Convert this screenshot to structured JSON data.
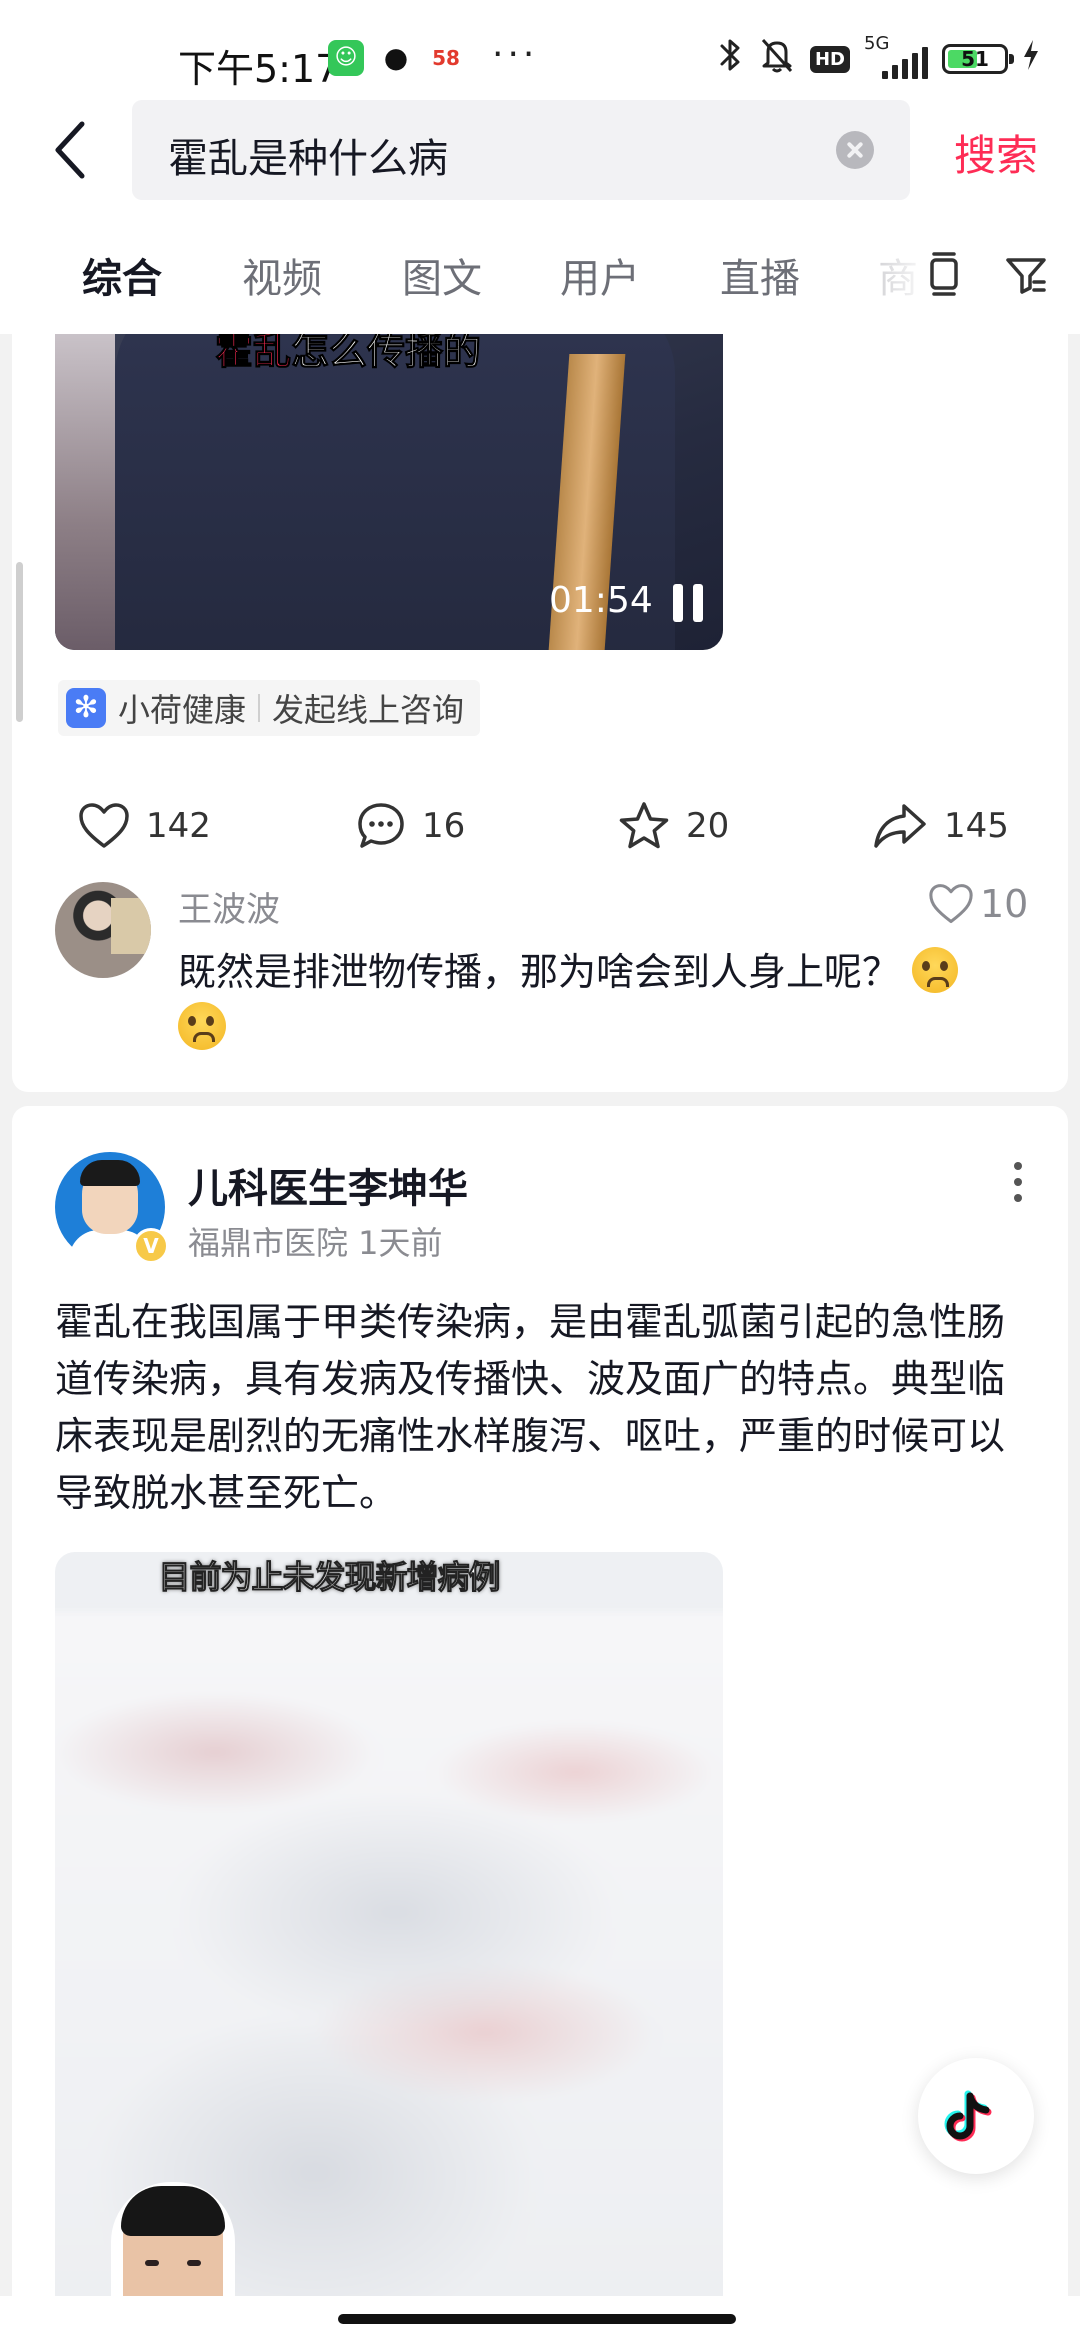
{
  "status_bar": {
    "time": "下午5:17",
    "overflow": "···",
    "network": "5G",
    "hd_label": "HD",
    "battery_level": "51"
  },
  "search": {
    "query": "霍乱是种什么病",
    "submit_label": "搜索"
  },
  "tabs": [
    {
      "label": "综合",
      "active": true
    },
    {
      "label": "视频",
      "active": false
    },
    {
      "label": "图文",
      "active": false
    },
    {
      "label": "用户",
      "active": false
    },
    {
      "label": "直播",
      "active": false
    },
    {
      "label": "商",
      "active": false
    }
  ],
  "post1": {
    "video_caption_highlight": "霍乱",
    "video_caption_rest": "怎么传播的",
    "duration": "01:54",
    "mini_app": {
      "name": "小荷健康",
      "action": "发起线上咨询"
    },
    "stats": {
      "likes": "142",
      "comments": "16",
      "favorites": "20",
      "shares": "145"
    },
    "top_comment": {
      "user": "王波波",
      "likes": "10",
      "text": "既然是排泄物传播，那为啥会到人身上呢？"
    }
  },
  "post2": {
    "author": "儿科医生李坤华",
    "verified_mark": "V",
    "meta": "福鼎市医院 1天前",
    "body": "霍乱在我国属于甲类传染病，是由霍乱弧菌引起的急性肠道传染病，具有发病及传播快、波及面广的特点。典型临床表现是剧烈的无痛性水样腹泻、呕吐，严重的时候可以导致脱水甚至死亡。",
    "video_caption": "目前为止未发现新增病例"
  },
  "colors": {
    "accent": "#fe2c55",
    "text_primary": "#161823",
    "text_secondary": "#8a8b91",
    "page_bg": "#f2f2f2"
  },
  "icons": {
    "back": "chevron-left-icon",
    "clear": "clear-circle-icon",
    "layout": "layout-toggle-icon",
    "filter": "filter-icon",
    "like": "heart-icon",
    "comment": "comment-bubble-icon",
    "favorite": "star-icon",
    "share": "share-arrow-icon",
    "more": "more-vertical-icon",
    "float": "douyin-logo-icon"
  }
}
